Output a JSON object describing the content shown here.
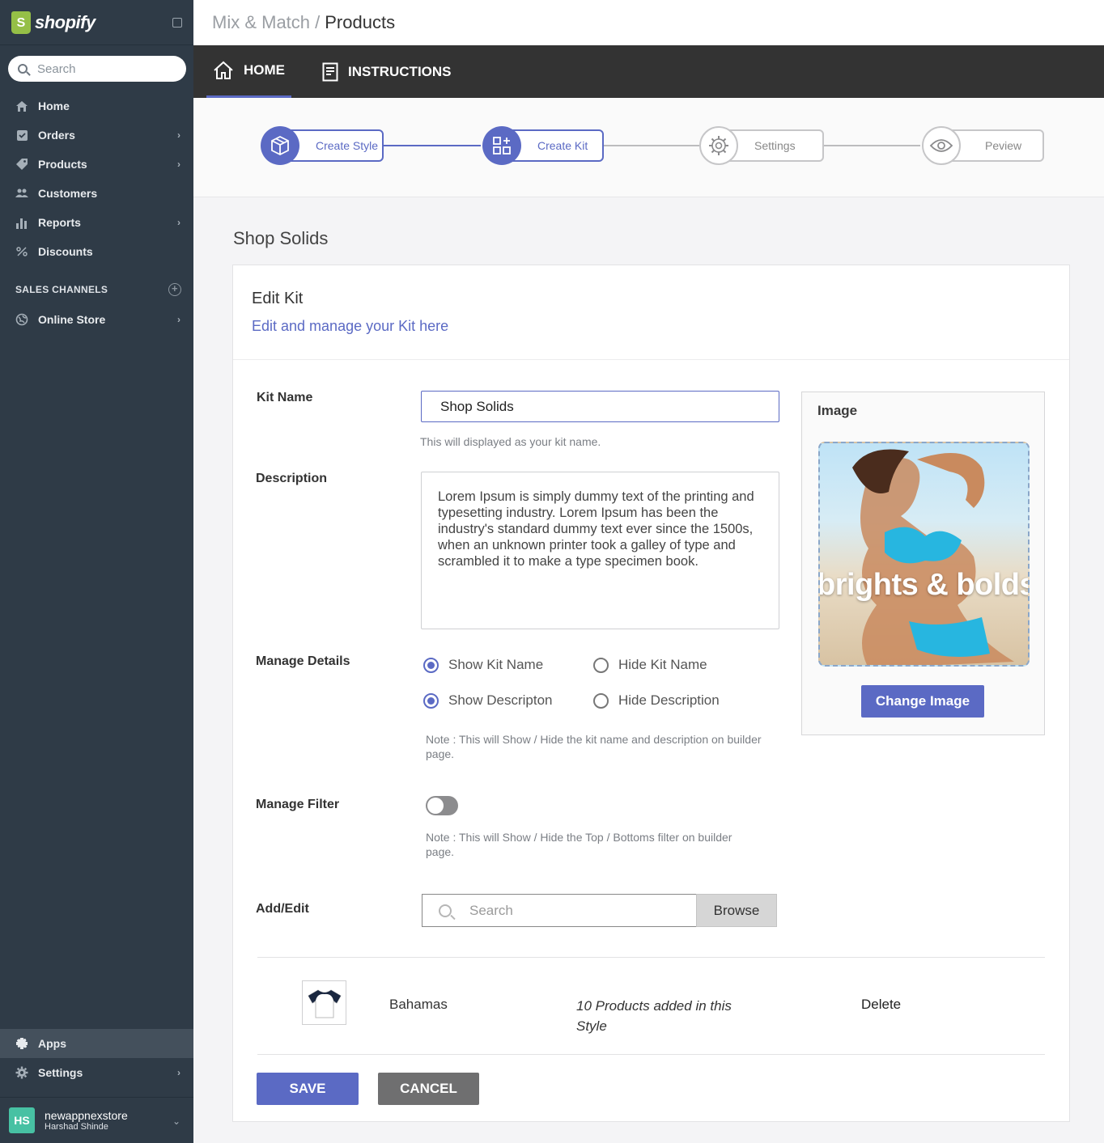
{
  "brand": {
    "name": "shopify"
  },
  "sidebar": {
    "search_placeholder": "Search",
    "items": [
      {
        "label": "Home",
        "icon": "home-icon"
      },
      {
        "label": "Orders",
        "icon": "orders-icon"
      },
      {
        "label": "Products",
        "icon": "tag-icon"
      },
      {
        "label": "Customers",
        "icon": "customers-icon"
      },
      {
        "label": "Reports",
        "icon": "reports-icon"
      },
      {
        "label": "Discounts",
        "icon": "discounts-icon"
      }
    ],
    "channels_title": "SALES CHANNELS",
    "channels": [
      {
        "label": "Online Store",
        "icon": "globe-icon"
      }
    ],
    "bottom": [
      {
        "label": "Apps",
        "icon": "puzzle-icon"
      },
      {
        "label": "Settings",
        "icon": "gear-icon"
      }
    ],
    "account": {
      "initials": "HS",
      "store": "newappnexstore",
      "user": "Harshad Shinde"
    }
  },
  "header": {
    "crumb_app": "Mix & Match /",
    "crumb_page": "Products"
  },
  "tabs": [
    {
      "label": "HOME",
      "icon": "home-outline-icon",
      "active": true
    },
    {
      "label": "INSTRUCTIONS",
      "icon": "document-icon",
      "active": false
    }
  ],
  "stepper": [
    {
      "label": "Create Style",
      "icon": "cube-icon",
      "done": true
    },
    {
      "label": "Create Kit",
      "icon": "grid-plus-icon",
      "done": true
    },
    {
      "label": "Settings",
      "icon": "gear-icon",
      "done": false
    },
    {
      "label": "Peview",
      "icon": "eye-icon",
      "done": false
    }
  ],
  "page": {
    "title": "Shop Solids"
  },
  "card": {
    "title": "Edit Kit",
    "subtitle": "Edit and manage your Kit here",
    "kit_name_label": "Kit Name",
    "kit_name_value": "Shop Solids",
    "kit_name_hint": "This will displayed as your kit name.",
    "description_label": "Description",
    "description_value": "Lorem Ipsum is simply dummy text of the printing and typesetting industry. Lorem Ipsum has been the industry's standard dummy text ever since the 1500s, when an unknown printer took a galley of type and scrambled it to make a type specimen book.",
    "manage_details_label": "Manage Details",
    "radios": {
      "show_kit_name": "Show Kit Name",
      "hide_kit_name": "Hide Kit Name",
      "show_description": "Show Descripton",
      "hide_description": "Hide Description"
    },
    "details_note": "Note : This will Show / Hide the kit name and description on builder page.",
    "manage_filter_label": "Manage Filter",
    "filter_enabled": false,
    "filter_note": "Note : This will Show / Hide the Top / Bottoms filter on builder page.",
    "add_edit_label": "Add/Edit",
    "search_placeholder": "Search",
    "browse_label": "Browse",
    "image_title": "Image",
    "image_text": "brights & bolds",
    "change_image_label": "Change Image",
    "product": {
      "name": "Bahamas",
      "count_text": "10 Products added in this  Style",
      "delete_label": "Delete"
    },
    "save_label": "SAVE",
    "cancel_label": "CANCEL"
  },
  "colors": {
    "accent": "#5b6ac4",
    "sidebar": "#2f3b47",
    "tabbar": "#333333"
  }
}
